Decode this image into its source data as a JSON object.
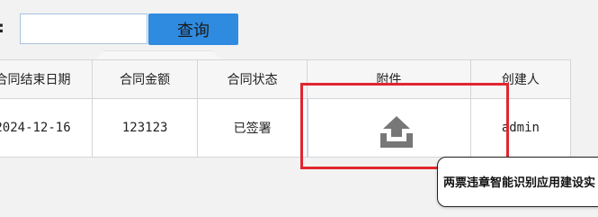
{
  "search": {
    "label": ":",
    "input_value": "",
    "input_placeholder": "",
    "button_label": "查询"
  },
  "table": {
    "headers": [
      "合同结束日期",
      "合同金额",
      "合同状态",
      "附件",
      "创建人"
    ],
    "rows": [
      {
        "end_date": "2024-12-16",
        "amount": "123123",
        "status": "已签署",
        "attachment_icon": "upload-icon",
        "creator": "admin"
      }
    ]
  },
  "tooltip": {
    "text": "两票违章智能识别应用建设实"
  },
  "colors": {
    "primary_button": "#2f8be0",
    "highlight": "#e0262f",
    "upload_icon": "#777777"
  }
}
